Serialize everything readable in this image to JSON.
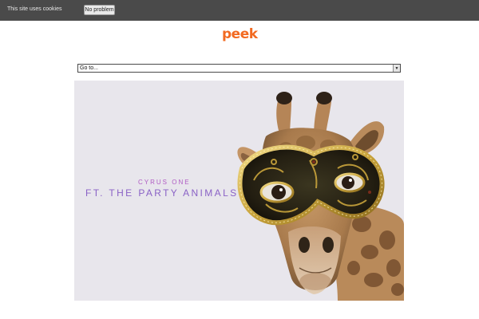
{
  "cookie_bar": {
    "message": "This site uses cookies",
    "button_label": "No problem"
  },
  "header": {
    "logo_text": "peek",
    "logo_color": "#f26a21"
  },
  "navigation": {
    "select_value": "Go to...",
    "arrow_icon": "dropdown-arrow"
  },
  "hero": {
    "kicker": "CYRUS ONE",
    "title": "FT. THE PARTY ANIMALS",
    "kicker_color": "#b05cc4",
    "title_color": "#8a62c6",
    "background_color": "#e8e6ec"
  }
}
